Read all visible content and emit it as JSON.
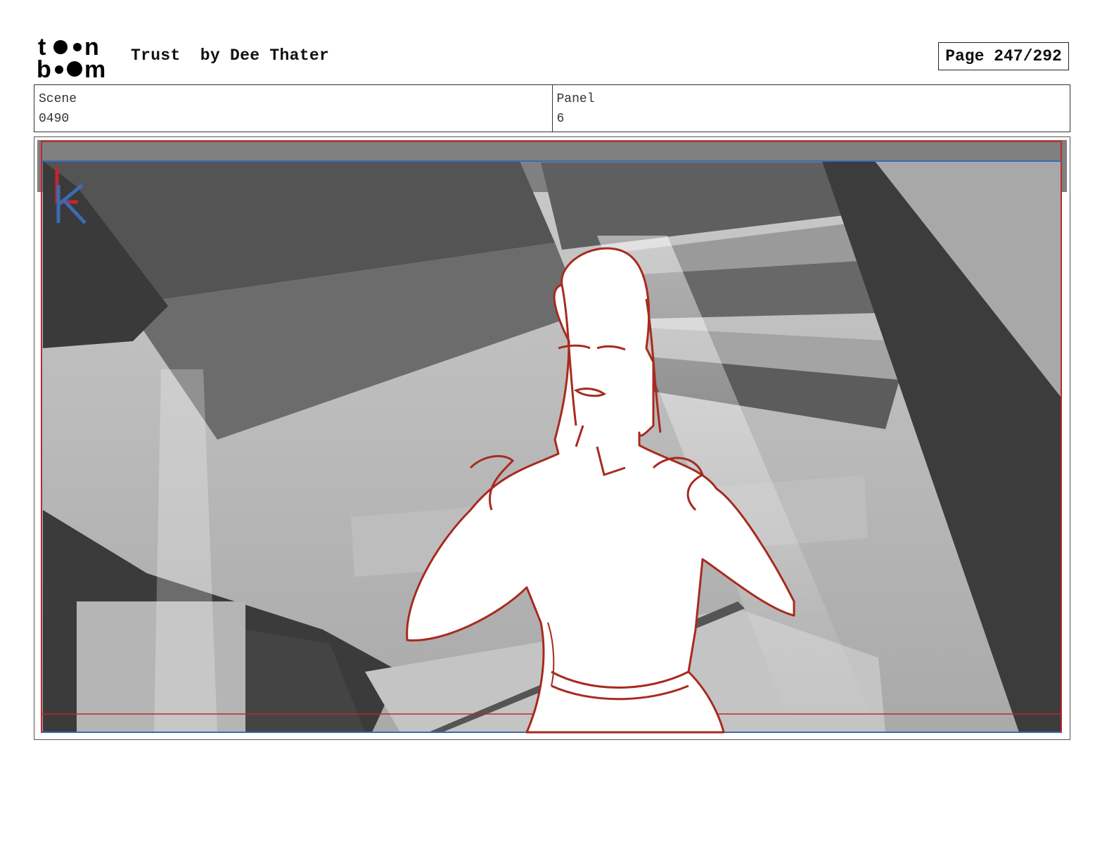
{
  "header": {
    "logo": {
      "line1": "toon",
      "line2": "boom",
      "icon": "toonboom-logo"
    },
    "title": "Trust  by Dee Thater",
    "page_label": "Page 247/292"
  },
  "meta": {
    "scene_label": "Scene",
    "scene_value": "0490",
    "panel_label": "Panel",
    "panel_value": "6"
  },
  "panel_image": {
    "icon": "storyboard-sketch",
    "overlay_marks": "LK",
    "colors": {
      "safe_frame": "#c0272d",
      "camera_frame": "#3a6bb5",
      "sketch": "#a82a1e"
    }
  }
}
